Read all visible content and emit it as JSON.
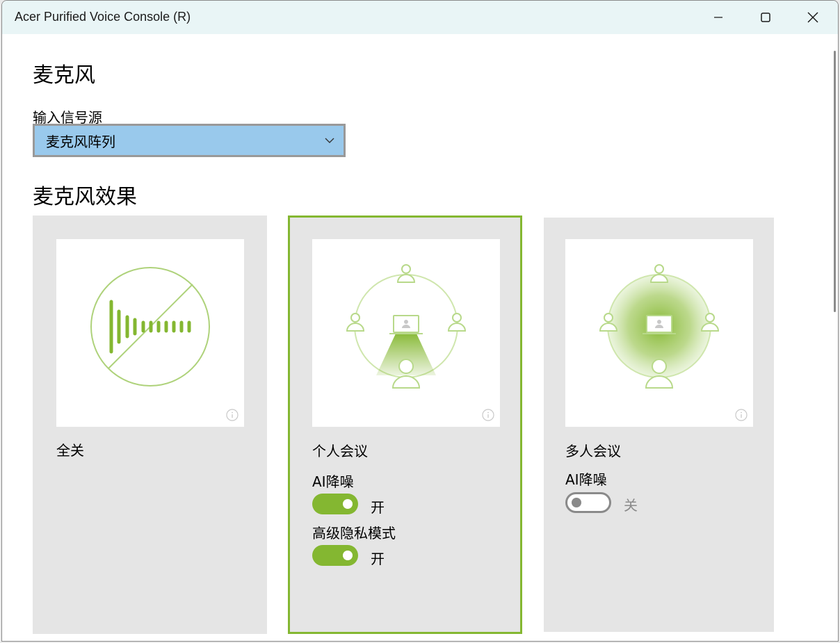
{
  "window": {
    "title": "Acer Purified Voice Console (R)"
  },
  "microphone": {
    "heading": "麦克风",
    "input_source_label": "输入信号源",
    "input_source_value": "麦克风阵列"
  },
  "effects": {
    "heading": "麦克风效果",
    "cards": [
      {
        "title": "全关",
        "selected": false,
        "options": []
      },
      {
        "title": "个人会议",
        "selected": true,
        "options": [
          {
            "label": "AI降噪",
            "state": "开",
            "on": true
          },
          {
            "label": "高级隐私模式",
            "state": "开",
            "on": true
          }
        ]
      },
      {
        "title": "多人会议",
        "selected": false,
        "options": [
          {
            "label": "AI降噪",
            "state": "关",
            "on": false
          }
        ]
      }
    ]
  },
  "colors": {
    "accent_green": "#84b731",
    "dropdown_bg": "#99c9ec",
    "card_bg": "#e5e5e5",
    "titlebar_bg": "#e9f5f6"
  },
  "icons": {
    "minimize": "minimize-icon",
    "maximize": "maximize-icon",
    "close": "close-icon",
    "dropdown": "chevron-down-icon",
    "info": "info-icon"
  }
}
